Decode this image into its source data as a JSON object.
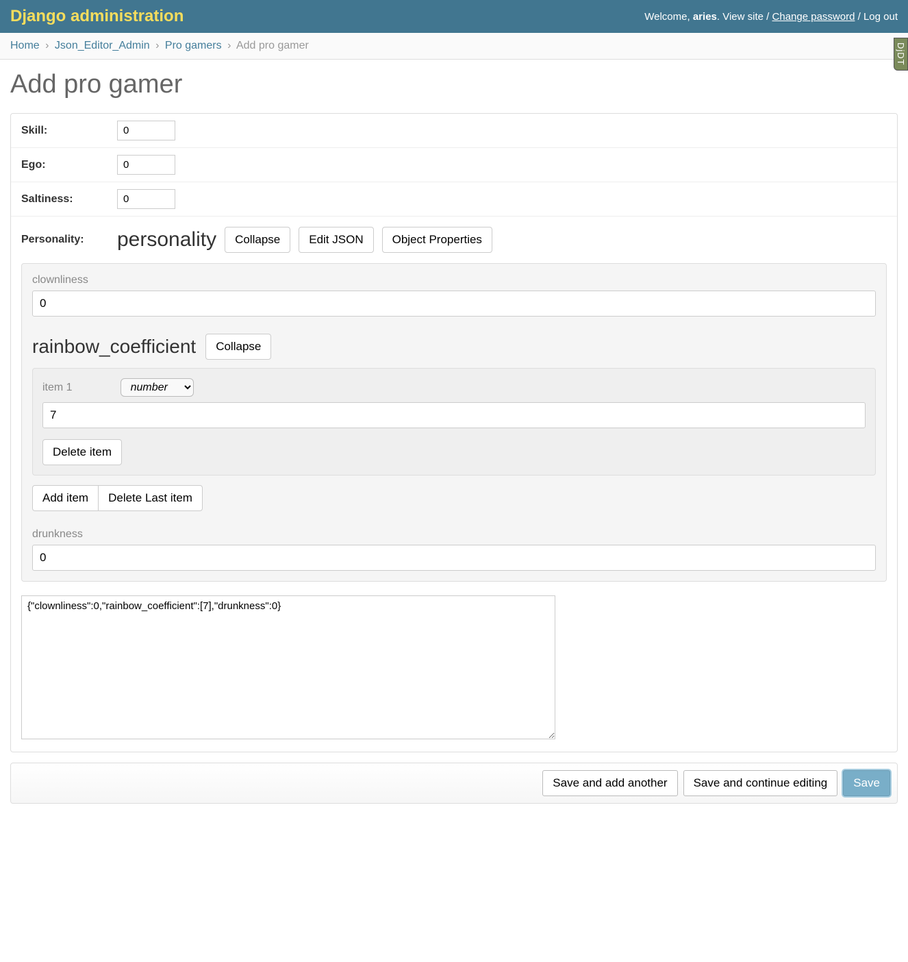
{
  "header": {
    "title": "Django administration",
    "welcome": "Welcome,",
    "username": "aries",
    "view_site": "View site",
    "change_password": "Change password",
    "logout": "Log out"
  },
  "djdt": "DjDT",
  "breadcrumbs": {
    "home": "Home",
    "app": "Json_Editor_Admin",
    "model": "Pro gamers",
    "current": "Add pro gamer"
  },
  "page_title": "Add pro gamer",
  "fields": {
    "skill": {
      "label": "Skill:",
      "value": "0"
    },
    "ego": {
      "label": "Ego:",
      "value": "0"
    },
    "saltiness": {
      "label": "Saltiness:",
      "value": "0"
    }
  },
  "personality": {
    "label": "Personality:",
    "title": "personality",
    "collapse": "Collapse",
    "edit_json": "Edit JSON",
    "object_properties": "Object Properties",
    "clownliness": {
      "label": "clownliness",
      "value": "0"
    },
    "rainbow_coefficient": {
      "title": "rainbow_coefficient",
      "collapse": "Collapse",
      "item_label": "item 1",
      "type_selected": "number",
      "item_value": "7",
      "delete_item": "Delete item",
      "add_item": "Add item",
      "delete_last": "Delete Last item"
    },
    "drunkness": {
      "label": "drunkness",
      "value": "0"
    },
    "raw_json": "{\"clownliness\":0,\"rainbow_coefficient\":[7],\"drunkness\":0}"
  },
  "submit": {
    "save_add_another": "Save and add another",
    "save_continue": "Save and continue editing",
    "save": "Save"
  }
}
